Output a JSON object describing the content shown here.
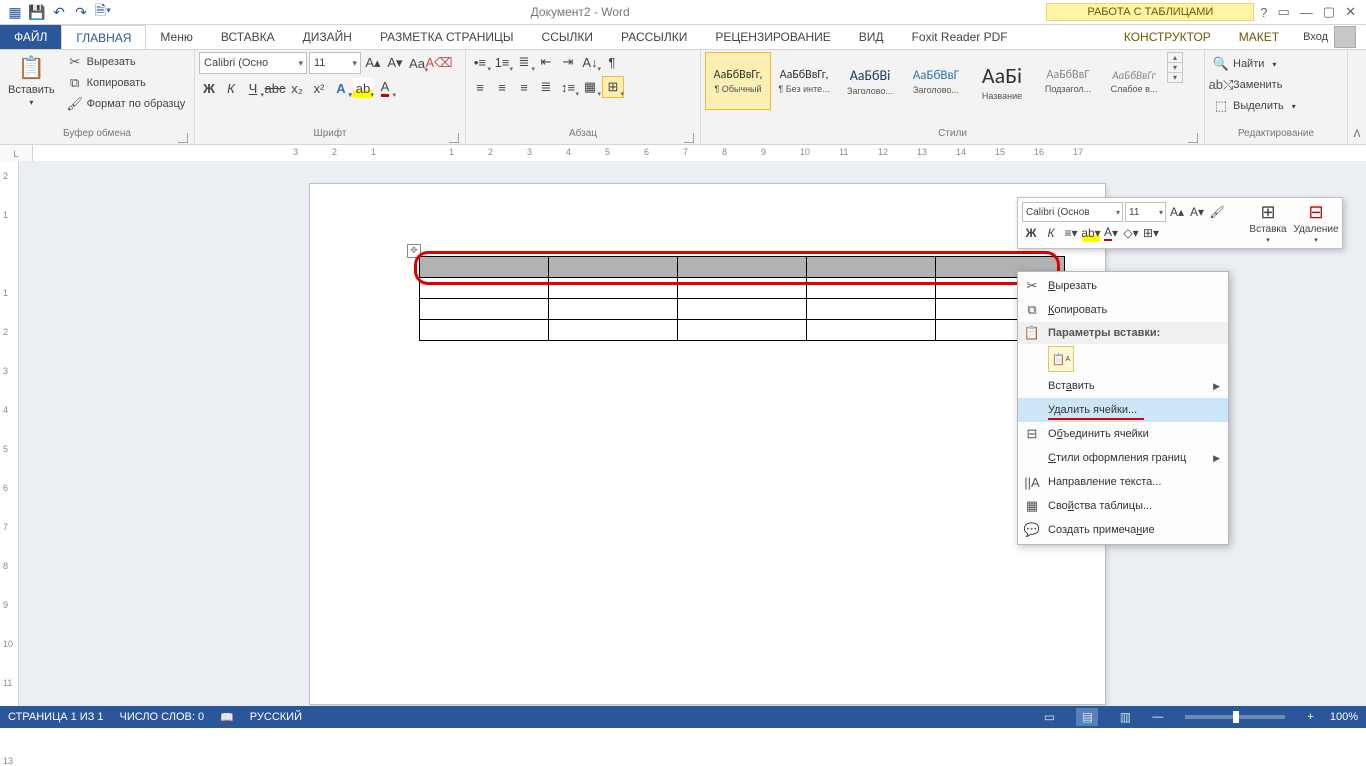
{
  "qat": {
    "title": "Документ2 - Word",
    "tabletools": "РАБОТА С ТАБЛИЦАМИ"
  },
  "sys": {
    "help": "?",
    "ropt": "▭",
    "min": "—",
    "max": "▢",
    "close": "✕"
  },
  "tabs": {
    "file": "ФАЙЛ",
    "home": "ГЛАВНАЯ",
    "menu": "Меню",
    "insert": "ВСТАВКА",
    "design": "ДИЗАЙН",
    "layout": "РАЗМЕТКА СТРАНИЦЫ",
    "refs": "ССЫЛКИ",
    "mail": "РАССЫЛКИ",
    "review": "РЕЦЕНЗИРОВАНИЕ",
    "view": "ВИД",
    "foxit": "Foxit Reader PDF",
    "constr": "КОНСТРУКТОР",
    "maket": "МАКЕТ",
    "signin": "Вход"
  },
  "ribbon": {
    "clipboard": {
      "paste": "Вставить",
      "cut": "Вырезать",
      "copy": "Копировать",
      "fmt": "Формат по образцу",
      "label": "Буфер обмена"
    },
    "font": {
      "name": "Calibri (Осно",
      "size": "11",
      "label": "Шрифт",
      "bold": "Ж",
      "italic": "К",
      "under": "Ч",
      "strike": "abc",
      "sub": "x₂",
      "sup": "x²"
    },
    "para": {
      "label": "Абзац"
    },
    "styles": {
      "label": "Стили",
      "items": [
        {
          "prev": "АаБбВвГг,",
          "name": "¶ Обычный",
          "sel": true,
          "size": "12px"
        },
        {
          "prev": "АаБбВвГг,",
          "name": "¶ Без инте...",
          "size": "12px"
        },
        {
          "prev": "АаБбВі",
          "name": "Заголово...",
          "size": "14px",
          "color": "#1f3864"
        },
        {
          "prev": "АаБбВвГ",
          "name": "Заголово...",
          "size": "13px",
          "color": "#2e74b5"
        },
        {
          "prev": "АаБі",
          "name": "Название",
          "size": "22px"
        },
        {
          "prev": "АаБбВвГ",
          "name": "Подзагол...",
          "size": "12px",
          "color": "#888"
        },
        {
          "prev": "АаБбВвГг",
          "name": "Слабое в...",
          "size": "11px",
          "color": "#888",
          "italic": true
        }
      ]
    },
    "editing": {
      "find": "Найти",
      "replace": "Заменить",
      "select": "Выделить",
      "label": "Редактирование"
    }
  },
  "ruler_h": [
    "3",
    "2",
    "1",
    "",
    "1",
    "2",
    "3",
    "4",
    "5",
    "6",
    "7",
    "8",
    "9",
    "10",
    "11",
    "12",
    "13",
    "14",
    "15",
    "16",
    "17"
  ],
  "ruler_v": [
    "2",
    "1",
    "",
    "1",
    "2",
    "3",
    "4",
    "5",
    "6",
    "7",
    "8",
    "9",
    "10",
    "11",
    "12",
    "13"
  ],
  "mini": {
    "font": "Calibri (Основ",
    "size": "11",
    "bold": "Ж",
    "italic": "К",
    "insert": "Вставка",
    "delete": "Удаление"
  },
  "ctx": {
    "cut": "Вырезать",
    "copy": "Копировать",
    "pasteopts": "Параметры вставки:",
    "insert": "Вставить",
    "delcells": "Удалить ячейки...",
    "merge": "Объединить ячейки",
    "borders": "Стили оформления границ",
    "textdir": "Направление текста...",
    "tblprops": "Свойства таблицы...",
    "comment": "Создать примечание"
  },
  "status": {
    "page": "СТРАНИЦА 1 ИЗ 1",
    "words": "ЧИСЛО СЛОВ: 0",
    "lang": "РУССКИЙ",
    "zoom": "100%"
  },
  "table": {
    "cols": 5,
    "rows": 4
  }
}
